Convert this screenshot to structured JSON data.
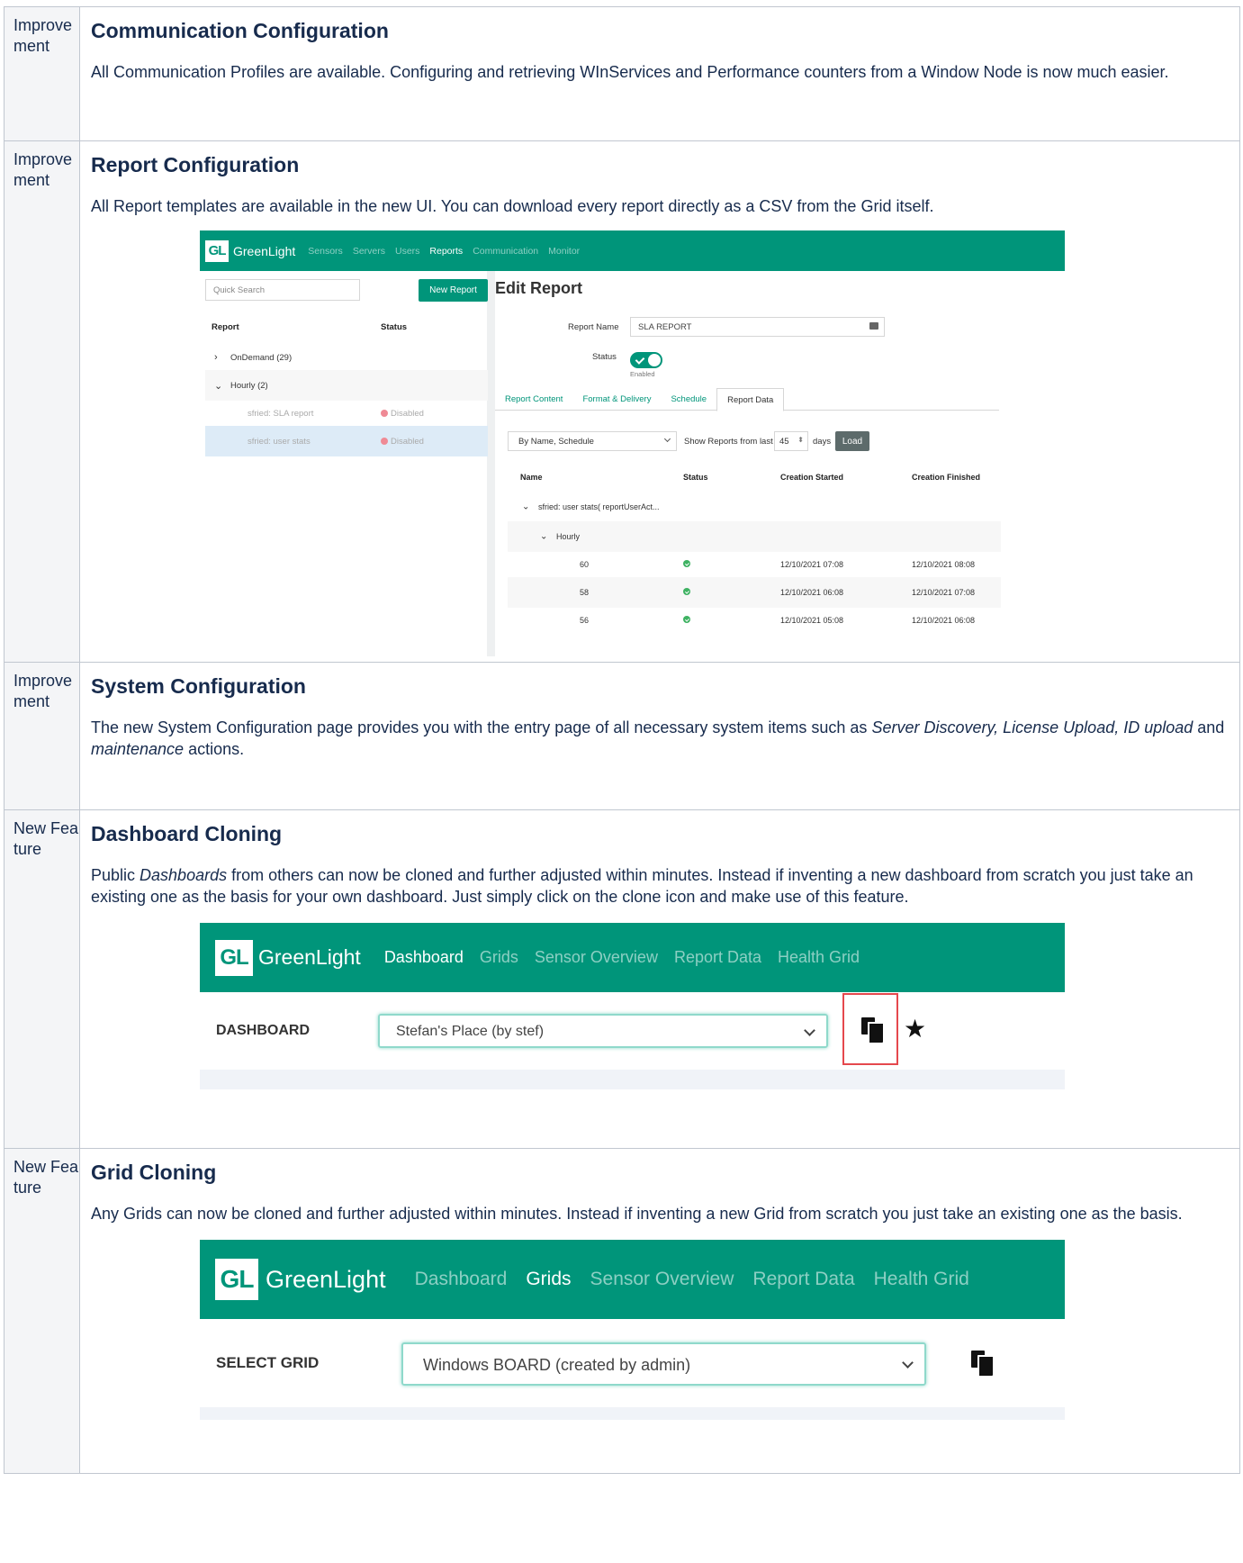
{
  "rows": [
    {
      "type": "Improvement",
      "title": "Communication Configuration",
      "text": "All Communication Profiles are available. Configuring and retrieving WInServices and Performance counters from a Window Node is now much easier."
    },
    {
      "type": "Improvement",
      "title": "Report Configuration",
      "text": "All Report templates are available in the new UI. You can download every report directly as a CSV from the Grid itself."
    },
    {
      "type": "Improvement",
      "title": "System Configuration",
      "text_parts": [
        "The new System Configuration page provides you with the entry page of all necessary system items such as ",
        "Server Discovery, License Upload, ID upload",
        " and ",
        "maintenance",
        " actions."
      ]
    },
    {
      "type": "New Feature",
      "title": "Dashboard Cloning",
      "text_parts": [
        "Public ",
        "Dashboards",
        " from others can now be cloned and further adjusted within minutes. Instead if inventing a new dashboard from scratch you just take an existing one as the basis for your own dashboard. Just simply click on the clone icon and make use of this feature."
      ]
    },
    {
      "type": "New Feature",
      "title": "Grid Cloning",
      "text": "Any Grids can now be cloned and further adjusted within minutes. Instead if inventing a new Grid from scratch you just take an existing one as the basis."
    }
  ],
  "report_shot": {
    "logo": "GL",
    "brand": "GreenLight",
    "nav": [
      "Sensors",
      "Servers",
      "Users",
      "Reports",
      "Communication",
      "Monitor"
    ],
    "quick_search": "Quick Search",
    "new_report": "New Report",
    "list_header": {
      "report": "Report",
      "status": "Status"
    },
    "groups": [
      {
        "label": "OnDemand (29)",
        "expand": "›"
      },
      {
        "label": "Hourly (2)",
        "expand": "⌄"
      }
    ],
    "items": [
      {
        "name": "sfried: SLA report",
        "status": "Disabled"
      },
      {
        "name": "sfried: user stats",
        "status": "Disabled"
      }
    ],
    "edit_title": "Edit Report",
    "report_name_label": "Report Name",
    "report_name_value": "SLA REPORT",
    "status_label": "Status",
    "enabled": "Enabled",
    "tabs": [
      "Report Content",
      "Format & Delivery",
      "Schedule",
      "Report Data"
    ],
    "sort_select": "By Name, Schedule",
    "show_from": "Show Reports from last",
    "days_value": "45",
    "days": "days",
    "load": "Load",
    "table_headers": [
      "Name",
      "Status",
      "Creation Started",
      "Creation Finished"
    ],
    "tree_root": "sfried: user stats( reportUserAct...",
    "tree_group": "Hourly",
    "table_rows": [
      {
        "name": "60",
        "started": "12/10/2021 07:08",
        "finished": "12/10/2021 08:08"
      },
      {
        "name": "58",
        "started": "12/10/2021 06:08",
        "finished": "12/10/2021 07:08"
      },
      {
        "name": "56",
        "started": "12/10/2021 05:08",
        "finished": "12/10/2021 06:08"
      }
    ]
  },
  "dashboard_shot": {
    "logo": "GL",
    "brand": "GreenLight",
    "nav": [
      "Dashboard",
      "Grids",
      "Sensor Overview",
      "Report Data",
      "Health Grid"
    ],
    "label": "DASHBOARD",
    "selected": "Stefan's Place (by stef)"
  },
  "grid_shot": {
    "logo": "GL",
    "brand": "GreenLight",
    "nav": [
      "Dashboard",
      "Grids",
      "Sensor Overview",
      "Report Data",
      "Health Grid"
    ],
    "label": "SELECT GRID",
    "selected": "Windows BOARD (created by admin)"
  }
}
